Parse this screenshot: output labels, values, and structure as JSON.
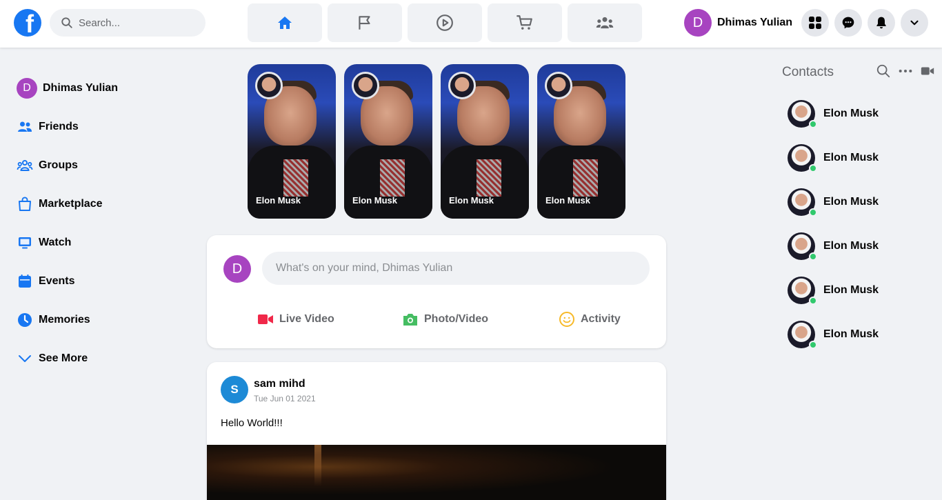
{
  "header": {
    "logo": "f",
    "search_placeholder": "Search...",
    "nav_tabs": [
      {
        "icon": "home-icon",
        "active": true
      },
      {
        "icon": "flag-icon",
        "active": false
      },
      {
        "icon": "video-icon",
        "active": false
      },
      {
        "icon": "cart-icon",
        "active": false
      },
      {
        "icon": "groups-icon",
        "active": false
      }
    ],
    "profile": {
      "initial": "D",
      "name": "Dhimas Yulian"
    },
    "actions": [
      "menu-grid-icon",
      "messenger-icon",
      "bell-icon",
      "chevron-down-icon"
    ]
  },
  "sidebar": {
    "profile": {
      "initial": "D",
      "name": "Dhimas Yulian"
    },
    "items": [
      {
        "label": "Friends",
        "icon": "friends-icon"
      },
      {
        "label": "Groups",
        "icon": "groups-icon"
      },
      {
        "label": "Marketplace",
        "icon": "bag-icon"
      },
      {
        "label": "Watch",
        "icon": "tv-icon"
      },
      {
        "label": "Events",
        "icon": "calendar-icon"
      },
      {
        "label": "Memories",
        "icon": "clock-icon"
      },
      {
        "label": "See More",
        "icon": "chevron-down-icon"
      }
    ]
  },
  "stories": [
    {
      "name": "Elon Musk"
    },
    {
      "name": "Elon Musk"
    },
    {
      "name": "Elon Musk"
    },
    {
      "name": "Elon Musk"
    }
  ],
  "composer": {
    "initial": "D",
    "placeholder": "What's on your mind, Dhimas Yulian",
    "actions": [
      {
        "label": "Live Video",
        "icon": "live-video-icon",
        "color": "#f02849"
      },
      {
        "label": "Photo/Video",
        "icon": "camera-icon",
        "color": "#45bd62"
      },
      {
        "label": "Activity",
        "icon": "smiley-icon",
        "color": "#f7b928"
      }
    ]
  },
  "post": {
    "initial": "S",
    "author": "sam mihd",
    "date": "Tue Jun 01 2021",
    "text": "Hello World!!!"
  },
  "contacts": {
    "title": "Contacts",
    "icons": [
      "search-icon",
      "more-icon",
      "video-camera-icon"
    ],
    "items": [
      {
        "name": "Elon Musk",
        "online": true
      },
      {
        "name": "Elon Musk",
        "online": true
      },
      {
        "name": "Elon Musk",
        "online": true
      },
      {
        "name": "Elon Musk",
        "online": true
      },
      {
        "name": "Elon Musk",
        "online": true
      },
      {
        "name": "Elon Musk",
        "online": true
      }
    ]
  },
  "colors": {
    "brand": "#1877f2",
    "background": "#f0f2f5",
    "avatar_d": "#a744c0",
    "avatar_s": "#1d8ad6",
    "online": "#31c96d"
  }
}
